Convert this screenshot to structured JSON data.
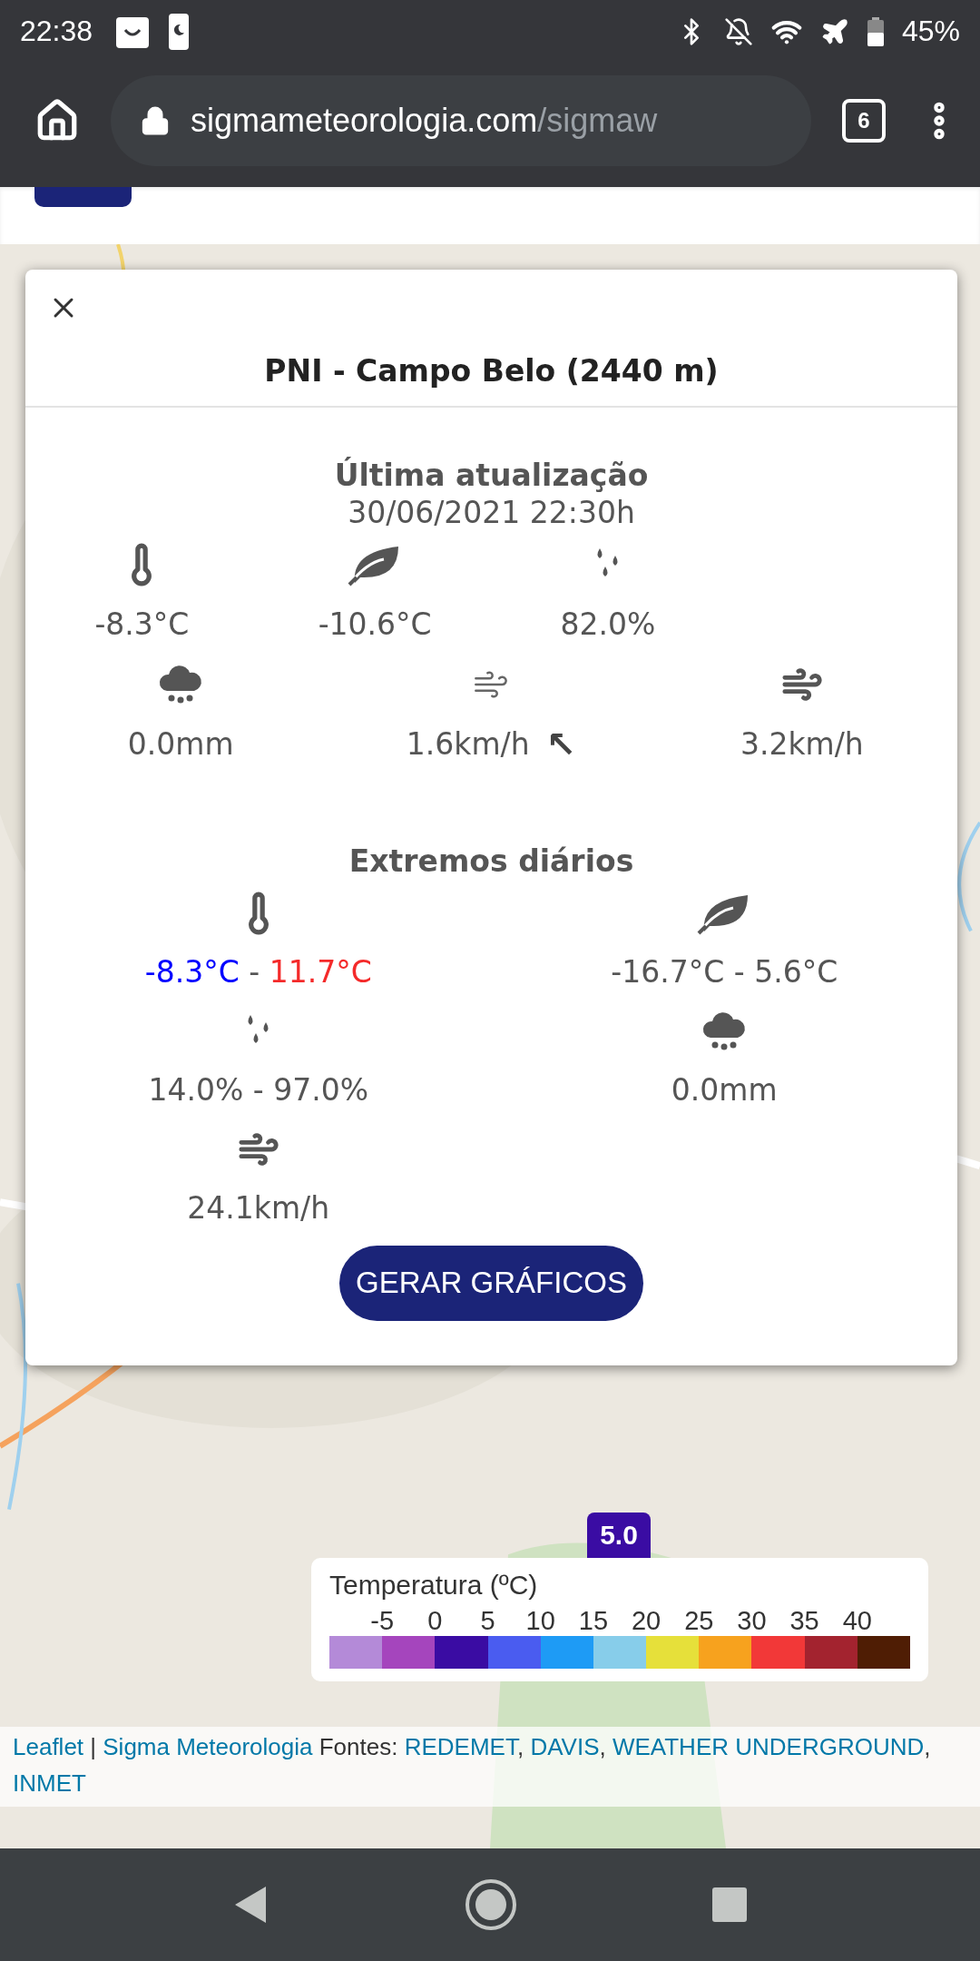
{
  "status_bar": {
    "time": "22:38",
    "battery": "45%"
  },
  "browser": {
    "url_host": "sigmameteorologia.com",
    "url_path": "/sigmaw",
    "tab_count": "6"
  },
  "popup": {
    "title": "PNI - Campo Belo (2440 m)",
    "current": {
      "heading": "Última atualização",
      "timestamp": "30/06/2021 22:30h",
      "readings": [
        {
          "kind": "temperature",
          "value": "-8.3°C"
        },
        {
          "kind": "dew_point",
          "value": "-10.6°C"
        },
        {
          "kind": "humidity",
          "value": "82.0%"
        }
      ],
      "readings_2": [
        {
          "kind": "rain",
          "value": "0.0mm"
        },
        {
          "kind": "wind",
          "value": "1.6km/h",
          "direction": "↖"
        },
        {
          "kind": "gust",
          "value": "3.2km/h"
        }
      ]
    },
    "extremes": {
      "heading": "Extremos diários",
      "items": [
        {
          "kind": "temperature",
          "low": "-8.3°C",
          "separator": "-",
          "high": "11.7°C",
          "colored": true
        },
        {
          "kind": "dew_point",
          "low": "-16.7°C",
          "separator": "-",
          "high": "5.6°C",
          "colored": false
        },
        {
          "kind": "humidity",
          "low": "14.0%",
          "separator": "-",
          "high": "97.0%",
          "colored": false
        },
        {
          "kind": "rain",
          "value": "0.0mm"
        },
        {
          "kind": "gust",
          "value": "24.1km/h"
        }
      ]
    },
    "button": "GERAR GRÁFICOS"
  },
  "map": {
    "marker": {
      "value": "5.0",
      "color": "#3a0ca3"
    },
    "legend": {
      "title": "Temperatura (ºC)",
      "labels": [
        "-5",
        "0",
        "5",
        "10",
        "15",
        "20",
        "25",
        "30",
        "35",
        "40"
      ],
      "swatches": [
        {
          "color": "#b48ad8"
        },
        {
          "color": "#a545bd"
        },
        {
          "color": "#3a0ca3"
        },
        {
          "color": "#4a5cf0"
        },
        {
          "color": "#1e9bf5"
        },
        {
          "color": "#87cdea"
        },
        {
          "color": "#e6e03a"
        },
        {
          "color": "#f7a21e"
        },
        {
          "color": "#f23838"
        },
        {
          "color": "#a3232f"
        },
        {
          "color": "#4f1d04"
        }
      ]
    },
    "attribution": [
      {
        "kind": "link",
        "text": "Leaflet"
      },
      {
        "kind": "text",
        "text": " | "
      },
      {
        "kind": "link",
        "text": "Sigma Meteorologia"
      },
      {
        "kind": "text",
        "text": " Fontes: "
      },
      {
        "kind": "link",
        "text": "REDEMET"
      },
      {
        "kind": "text",
        "text": ", "
      },
      {
        "kind": "link",
        "text": "DAVIS"
      },
      {
        "kind": "text",
        "text": ", "
      },
      {
        "kind": "link",
        "text": "WEATHER UNDERGROUND"
      },
      {
        "kind": "text",
        "text": ", "
      },
      {
        "kind": "link",
        "text": "INMET"
      }
    ]
  }
}
